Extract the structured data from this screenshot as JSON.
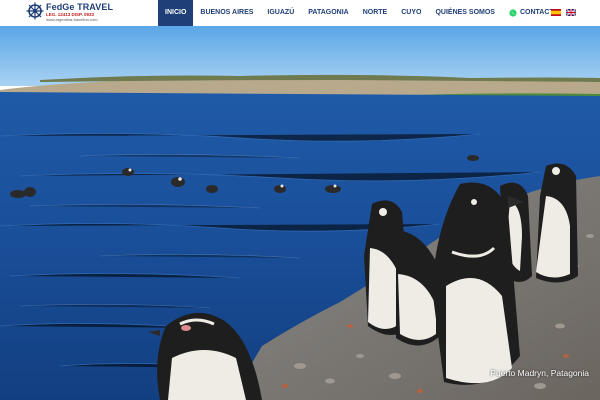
{
  "brand": {
    "name": "FedGe TRAVEL",
    "license": "LEG. 12413 DISP. 0933",
    "url": "www.argentina-travelfun.com"
  },
  "nav": {
    "items": [
      {
        "label": "INICIO",
        "active": true
      },
      {
        "label": "BUENOS AIRES",
        "active": false
      },
      {
        "label": "IGUAZÚ",
        "active": false
      },
      {
        "label": "PATAGONIA",
        "active": false
      },
      {
        "label": "NORTE",
        "active": false
      },
      {
        "label": "CUYO",
        "active": false
      },
      {
        "label": "QUIÉNES SOMOS",
        "active": false
      }
    ],
    "contact_label": "CONTACTO",
    "contact_icon": "whatsapp-icon"
  },
  "languages": [
    {
      "icon": "flag-spain-icon"
    },
    {
      "icon": "flag-uk-icon"
    }
  ],
  "hero": {
    "caption": "Puerto Madryn, Patagonia"
  },
  "colors": {
    "brand_blue": "#1f3f78",
    "brand_red": "#c21c1c",
    "whatsapp_green": "#25d366"
  }
}
